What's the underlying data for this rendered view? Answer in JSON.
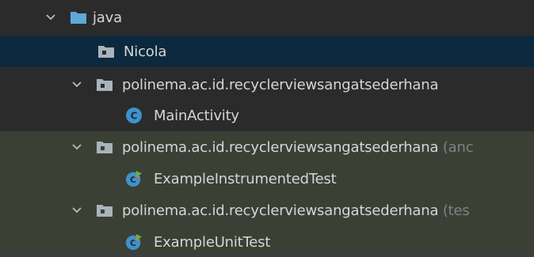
{
  "project_tree": {
    "java": {
      "label": "java",
      "icon": "source-folder-icon",
      "expanded": true
    },
    "nicola": {
      "label": "Nicola",
      "icon": "package-folder-icon",
      "selected": true
    },
    "main_package": {
      "label": "polinema.ac.id.recyclerviewsangatsederhana",
      "icon": "package-folder-icon",
      "expanded": true
    },
    "main_activity": {
      "label": "MainActivity",
      "icon": "class-icon"
    },
    "android_test_package": {
      "label": "polinema.ac.id.recyclerviewsangatsederhana",
      "hint": "(anc",
      "icon": "package-folder-icon",
      "expanded": true
    },
    "instrumented_test": {
      "label": "ExampleInstrumentedTest",
      "icon": "test-class-icon"
    },
    "unit_test_package": {
      "label": "polinema.ac.id.recyclerviewsangatsederhana",
      "hint": "(tes",
      "icon": "package-folder-icon",
      "expanded": true
    },
    "unit_test": {
      "label": "ExampleUnitTest",
      "icon": "test-class-icon"
    }
  },
  "colors": {
    "background": "#2b2b2b",
    "selected_row": "#0d293e",
    "test_rows": "#3a4034",
    "folder_blue": "#5fa8d8",
    "package_gray": "#a8b3bc",
    "class_blue": "#3d92cc",
    "test_green": "#62b543"
  }
}
